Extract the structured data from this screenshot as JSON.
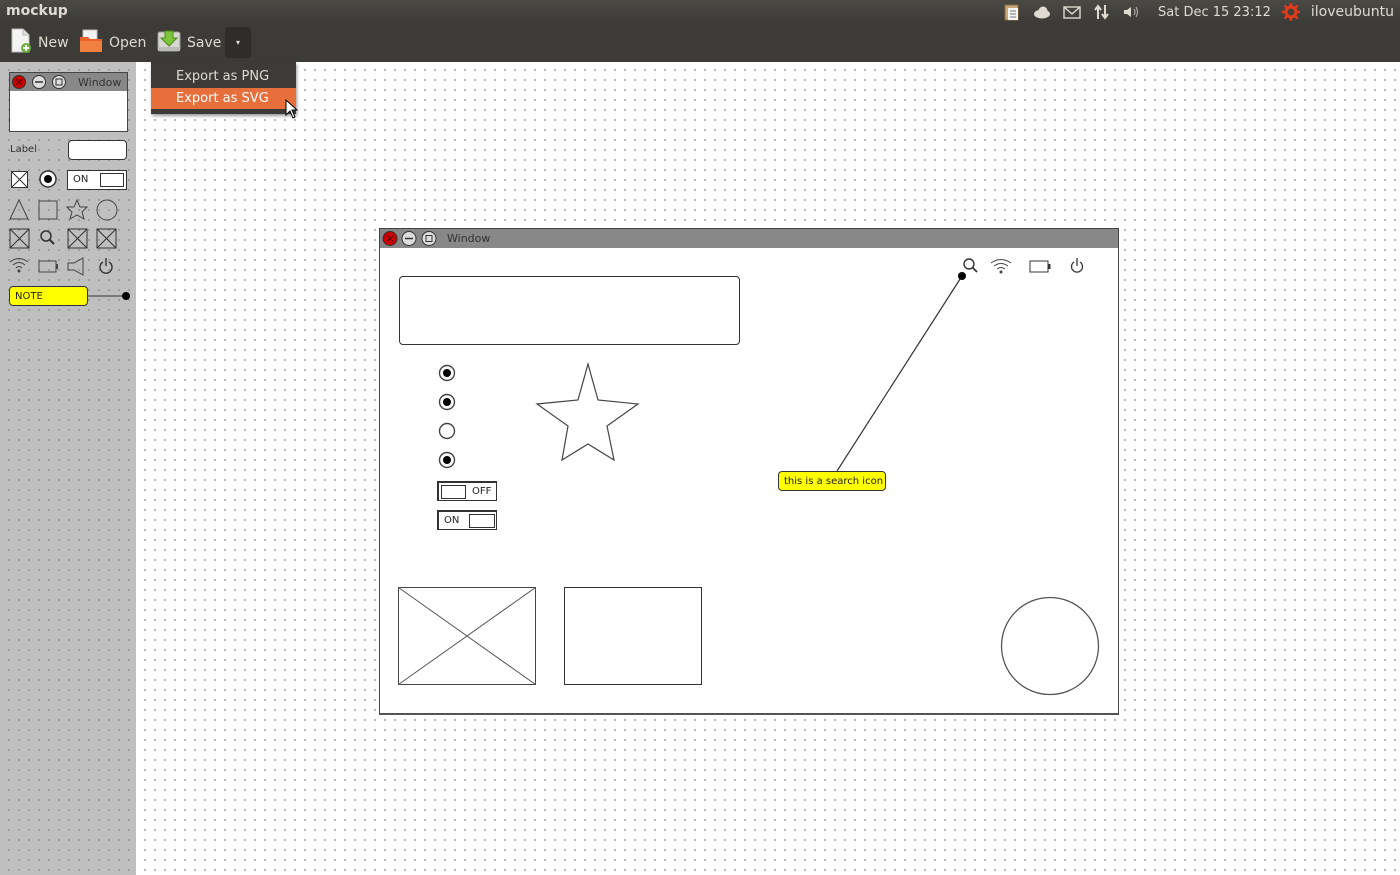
{
  "app": {
    "title": "mockup"
  },
  "indicators": {
    "icons": [
      "clipboard-icon",
      "cloud-icon",
      "mail-icon",
      "network-icon",
      "volume-icon"
    ],
    "datetime": "Sat Dec 15  23:12",
    "user": "iloveubuntu"
  },
  "toolbar": {
    "new_label": "New",
    "open_label": "Open",
    "save_label": "Save",
    "dropdown_glyph": "▾"
  },
  "export_menu": {
    "items": [
      {
        "label": "Export as PNG",
        "active": false
      },
      {
        "label": "Export as SVG",
        "active": true
      }
    ]
  },
  "palette": {
    "window_label": "Window",
    "label_label": "Label",
    "toggle_on_label": "ON",
    "note_label": "NOTE"
  },
  "mockup_window": {
    "title": "Window",
    "radios": [
      true,
      true,
      false,
      true
    ],
    "toggle_off_label": "OFF",
    "toggle_on_label": "ON",
    "note_text": "this is a search icon",
    "header_icons": [
      "search-icon",
      "wifi-icon",
      "battery-icon",
      "power-icon"
    ]
  },
  "colors": {
    "accent": "#e76f3c",
    "note": "#ffff00",
    "close_button": "#cc0000",
    "topbar": "#3c3b37"
  }
}
